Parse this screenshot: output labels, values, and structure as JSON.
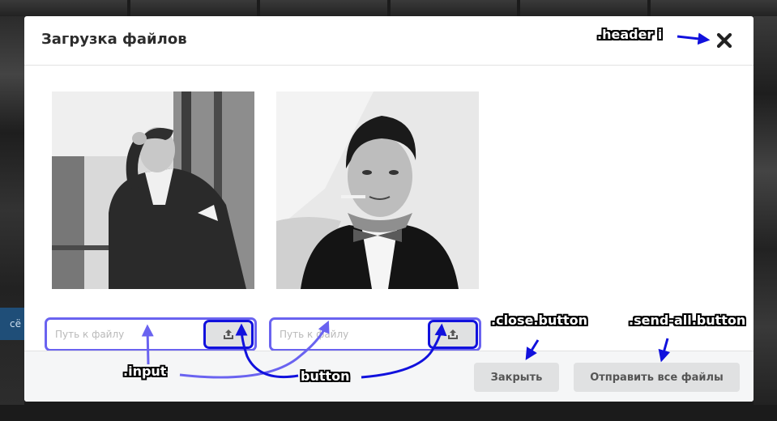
{
  "modal": {
    "title": "Загрузка файлов",
    "cards": [
      {
        "photo_alt": "",
        "input_placeholder": "Путь к файлу",
        "input_value": ""
      },
      {
        "photo_alt": "",
        "input_placeholder": "Путь к файлу",
        "input_value": ""
      }
    ],
    "actions": {
      "close_label": "Закрыть",
      "send_all_label": "Отправить все файлы"
    }
  },
  "annotations": {
    "header_icon": ".header i",
    "input": ".input",
    "button": "button",
    "close_button": ".close.button",
    "send_all_button": ".send-all.button"
  },
  "background": {
    "badge_text": "сё"
  },
  "icons": {
    "close": "close-icon",
    "upload": "upload-icon"
  },
  "colors": {
    "highlight_light": "#6a63f0",
    "highlight_dark": "#1111dd",
    "button_bg": "#e0e1e2",
    "footer_bg": "#f5f6f7"
  }
}
